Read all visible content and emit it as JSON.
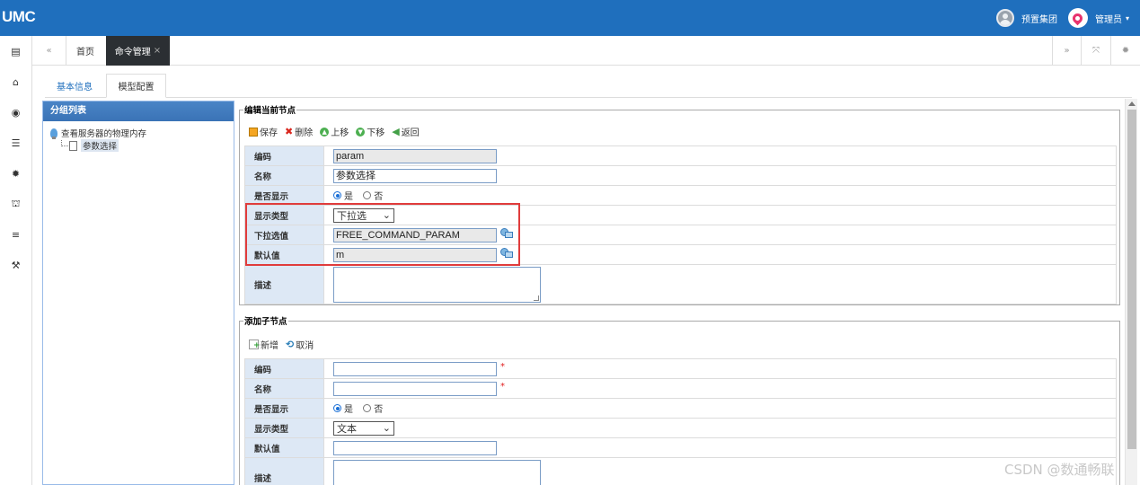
{
  "app": {
    "logo": "UMC"
  },
  "topbar": {
    "org": "预置集团",
    "user": "管理员",
    "caret": "▾"
  },
  "sidebar_icons": [
    "id-card-icon",
    "bank-icon",
    "eye-icon",
    "table-icon",
    "gear-icon",
    "sitemap-icon",
    "list-icon",
    "wrench-icon"
  ],
  "sidebar_glyphs": [
    "▤",
    "⌂",
    "◉",
    "☰",
    "✹",
    "⛫",
    "≡",
    "⚒"
  ],
  "tabs": {
    "prev": "«",
    "home": "首页",
    "active": "命令管理",
    "close": "×",
    "next": "»",
    "fullscreen": "⤧",
    "settings": "✹"
  },
  "subtabs": {
    "basic": "基本信息",
    "model": "模型配置"
  },
  "group_panel": {
    "title": "分组列表",
    "root": "查看服务器的物理内存",
    "child": "参数选择"
  },
  "edit_node": {
    "legend": "编辑当前节点",
    "toolbar": {
      "save": "保存",
      "delete": "删除",
      "up": "上移",
      "down": "下移",
      "back": "返回"
    },
    "fields": {
      "code_label": "编码",
      "code_value": "param",
      "name_label": "名称",
      "name_value": "参数选择",
      "display_label": "是否显示",
      "yes": "是",
      "no": "否",
      "type_label": "显示类型",
      "type_value": "下拉选",
      "options_label": "下拉选值",
      "options_value": "FREE_COMMAND_PARAM",
      "default_label": "默认值",
      "default_value": "m",
      "desc_label": "描述"
    }
  },
  "add_child": {
    "legend": "添加子节点",
    "toolbar": {
      "new": "新增",
      "cancel": "取消"
    },
    "fields": {
      "code_label": "编码",
      "required": "*",
      "name_label": "名称",
      "display_label": "是否显示",
      "yes": "是",
      "no": "否",
      "type_label": "显示类型",
      "type_value": "文本",
      "default_label": "默认值",
      "desc_label": "描述"
    }
  },
  "watermark": "CSDN @数通畅联",
  "colors": {
    "topbar": "#1f6fbd",
    "highlight": "#e03c3c",
    "label_bg": "#dde8f5",
    "active_tab": "#2b2f33"
  }
}
